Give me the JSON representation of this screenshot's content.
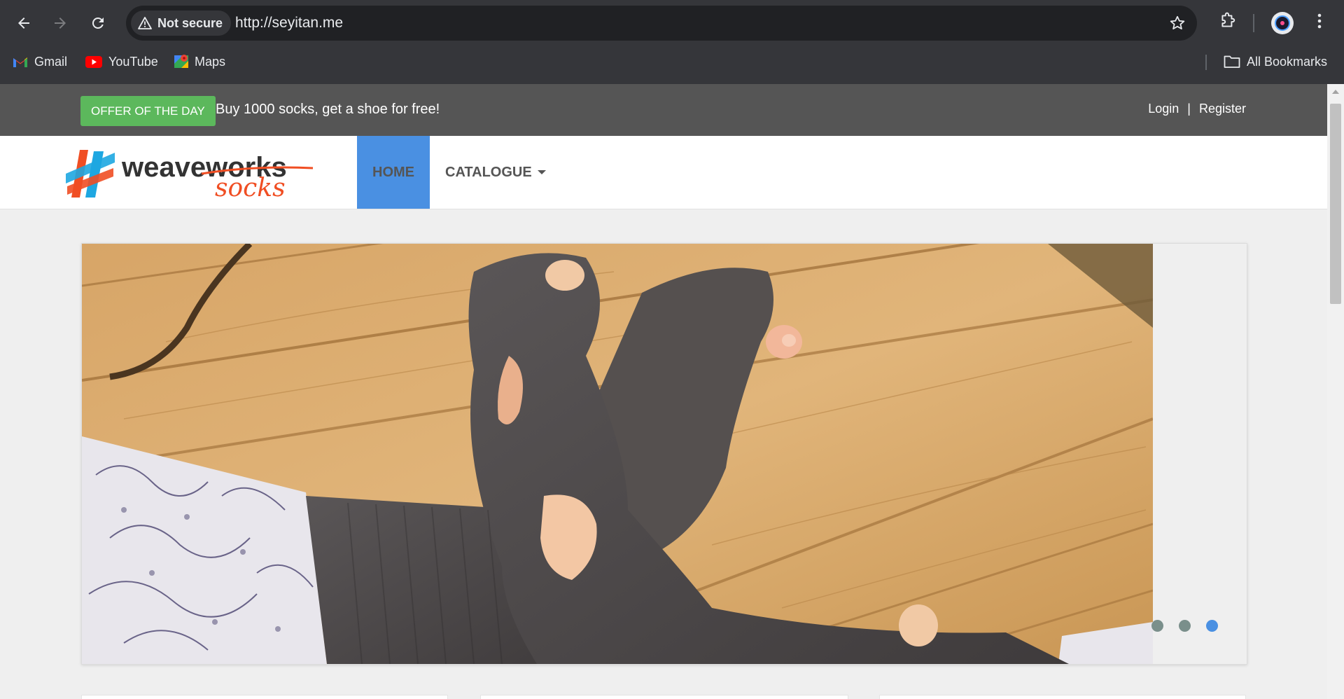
{
  "browser": {
    "security_label": "Not secure",
    "url": "http://seyitan.me",
    "bookmarks": [
      {
        "label": "Gmail",
        "icon": "gmail-icon"
      },
      {
        "label": "YouTube",
        "icon": "youtube-icon"
      },
      {
        "label": "Maps",
        "icon": "maps-icon"
      }
    ],
    "all_bookmarks_label": "All Bookmarks"
  },
  "topbar": {
    "offer_label": "OFFER OF THE DAY",
    "offer_text": "Buy 1000 socks, get a shoe for free!",
    "login_label": "Login",
    "separator": "|",
    "register_label": "Register"
  },
  "logo": {
    "word1": "weaveworks",
    "word2": "socks"
  },
  "nav": {
    "home_label": "HOME",
    "catalogue_label": "CATALOGUE"
  },
  "carousel": {
    "slide_count": 3,
    "active_index": 2
  },
  "colors": {
    "offer_green": "#5cb85c",
    "nav_active_blue": "#4a90e2",
    "topbar_gray": "#555555",
    "logo_orange": "#f04e23",
    "logo_blue": "#1ea7e1"
  }
}
